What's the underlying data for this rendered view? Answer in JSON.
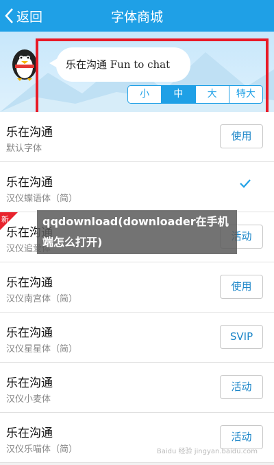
{
  "header": {
    "back_label": "返回",
    "title": "字体商城"
  },
  "preview": {
    "sample_text": "乐在沟通 Fun to chat",
    "sizes": [
      "小",
      "中",
      "大",
      "特大"
    ],
    "selected_size": "中"
  },
  "fonts": [
    {
      "name": "乐在沟通",
      "desc": "默认字体",
      "action": "使用"
    },
    {
      "name": "乐在沟通",
      "desc": "汉仪蝶语体（简）",
      "action": ""
    },
    {
      "name": "乐在沟通",
      "desc": "汉仪追爱体",
      "action": "活动",
      "new_tag": "新"
    },
    {
      "name": "乐在沟通",
      "desc": "汉仪南宫体（简）",
      "action": "使用"
    },
    {
      "name": "乐在沟通",
      "desc": "汉仪星星体（简）",
      "action": "SVIP"
    },
    {
      "name": "乐在沟通",
      "desc": "汉仪小麦体",
      "action": "活动"
    },
    {
      "name": "乐在沟通",
      "desc": "汉仪乐喵体（简）",
      "action": "活动"
    }
  ],
  "overlay_text": "qqdownload(downloader在手机端怎么打开)",
  "watermark": "Baidu 经验 jingyan.baidu.com",
  "colors": {
    "accent": "#1fa0e6",
    "highlight": "#e81a27"
  }
}
